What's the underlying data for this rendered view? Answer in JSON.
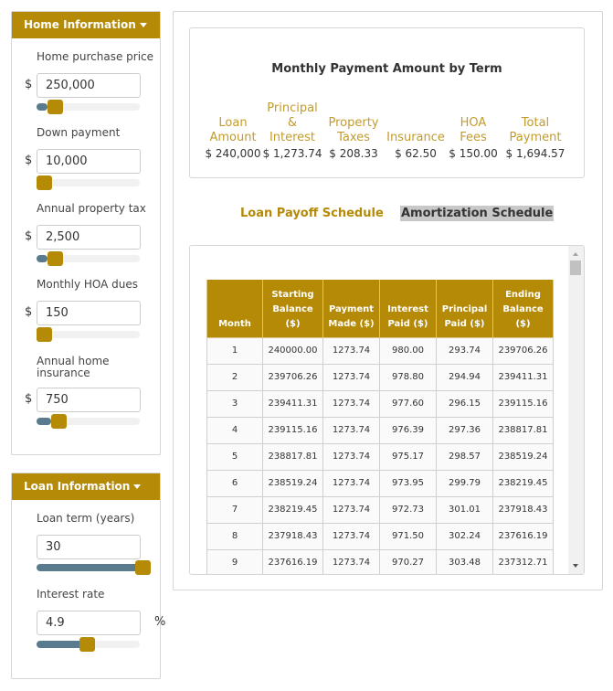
{
  "home_panel": {
    "title": "Home Information",
    "fields": [
      {
        "label": "Home purchase price",
        "prefix": "$",
        "value": "250,000",
        "slider_fraction": 0.11
      },
      {
        "label": "Down payment",
        "prefix": "$",
        "value": "10,000",
        "slider_fraction": 0.0
      },
      {
        "label": "Annual property tax",
        "prefix": "$",
        "value": "2,500",
        "slider_fraction": 0.11
      },
      {
        "label": "Monthly HOA dues",
        "prefix": "$",
        "value": "150",
        "slider_fraction": 0.0
      },
      {
        "label": "Annual home\ninsurance",
        "prefix": "$",
        "value": "750",
        "slider_fraction": 0.14
      }
    ]
  },
  "loan_panel": {
    "title": "Loan Information",
    "fields": [
      {
        "label": "Loan term (years)",
        "value": "30",
        "slider_fraction": 1.0
      },
      {
        "label": "Interest rate",
        "value": "4.9",
        "suffix": "%",
        "slider_fraction": 0.49
      }
    ]
  },
  "summary": {
    "title": "Monthly Payment Amount by Term",
    "columns": [
      {
        "label": "Loan\nAmount",
        "value": "$ 240,000"
      },
      {
        "label": "Principal\n&\nInterest",
        "value": "$ 1,273.74"
      },
      {
        "label": "Property\nTaxes",
        "value": "$ 208.33"
      },
      {
        "label": "Insurance",
        "value": "$ 62.50"
      },
      {
        "label": "HOA\nFees",
        "value": "$ 150.00"
      },
      {
        "label": "Total\nPayment",
        "value": "$ 1,694.57"
      }
    ]
  },
  "tabs": {
    "payoff": "Loan Payoff Schedule",
    "amortization": "Amortization Schedule",
    "active": "amortization"
  },
  "schedule": {
    "headers": [
      "Month",
      "Starting Balance ($)",
      "Payment Made ($)",
      "Interest Paid ($)",
      "Principal Paid ($)",
      "Ending Balance ($)"
    ],
    "rows": [
      [
        "1",
        "240000.00",
        "1273.74",
        "980.00",
        "293.74",
        "239706.26"
      ],
      [
        "2",
        "239706.26",
        "1273.74",
        "978.80",
        "294.94",
        "239411.31"
      ],
      [
        "3",
        "239411.31",
        "1273.74",
        "977.60",
        "296.15",
        "239115.16"
      ],
      [
        "4",
        "239115.16",
        "1273.74",
        "976.39",
        "297.36",
        "238817.81"
      ],
      [
        "5",
        "238817.81",
        "1273.74",
        "975.17",
        "298.57",
        "238519.24"
      ],
      [
        "6",
        "238519.24",
        "1273.74",
        "973.95",
        "299.79",
        "238219.45"
      ],
      [
        "7",
        "238219.45",
        "1273.74",
        "972.73",
        "301.01",
        "237918.43"
      ],
      [
        "8",
        "237918.43",
        "1273.74",
        "971.50",
        "302.24",
        "237616.19"
      ],
      [
        "9",
        "237616.19",
        "1273.74",
        "970.27",
        "303.48",
        "237312.71"
      ]
    ]
  }
}
